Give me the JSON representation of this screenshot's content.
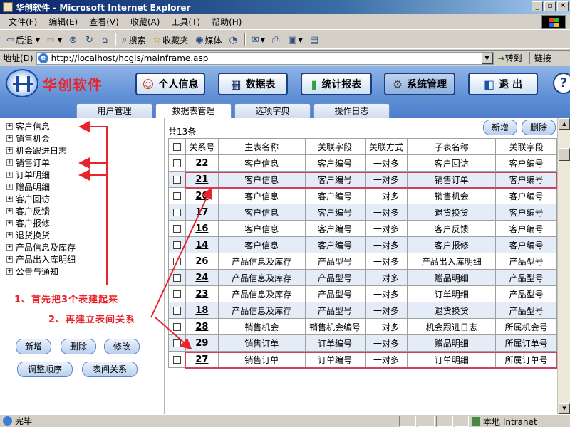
{
  "window": {
    "title": "华创软件 - Microsoft Internet Explorer",
    "buttons": [
      "_",
      "▫",
      "✕"
    ]
  },
  "menu": [
    "文件(F)",
    "编辑(E)",
    "查看(V)",
    "收藏(A)",
    "工具(T)",
    "帮助(H)"
  ],
  "toolbar": {
    "back": "后退",
    "search": "搜索",
    "favorites": "收藏夹",
    "media": "媒体"
  },
  "address": {
    "label": "地址(D)",
    "url": "http://localhost/hcgis/mainframe.asp",
    "go": "转到",
    "links": "链接"
  },
  "app": {
    "logo": "华创软件",
    "nav": [
      "个人信息",
      "数据表",
      "统计报表",
      "系统管理",
      "退 出"
    ],
    "help": "?",
    "tabs": [
      "用户管理",
      "数据表管理",
      "选项字典",
      "操作日志"
    ]
  },
  "tree": [
    "客户信息",
    "销售机会",
    "机会跟进日志",
    "销售订单",
    "订单明细",
    "赠品明细",
    "客户回访",
    "客户反馈",
    "客户报修",
    "退货换货",
    "产品信息及库存",
    "产品出入库明细",
    "公告与通知"
  ],
  "left_buttons": {
    "add": "新增",
    "delete": "删除",
    "edit": "修改",
    "reorder": "调整顺序",
    "relations": "表间关系"
  },
  "annotations": {
    "step1": "1、首先把3个表建起来",
    "step2": "2、再建立表间关系"
  },
  "table": {
    "count": "共13条",
    "add": "新增",
    "delete": "删除",
    "headers": [
      "关系号",
      "主表名称",
      "关联字段",
      "关联方式",
      "子表名称",
      "关联字段"
    ],
    "rows": [
      [
        "22",
        "客户信息",
        "客户编号",
        "一对多",
        "客户回访",
        "客户编号"
      ],
      [
        "21",
        "客户信息",
        "客户编号",
        "一对多",
        "销售订单",
        "客户编号"
      ],
      [
        "20",
        "客户信息",
        "客户编号",
        "一对多",
        "销售机会",
        "客户编号"
      ],
      [
        "17",
        "客户信息",
        "客户编号",
        "一对多",
        "退货换货",
        "客户编号"
      ],
      [
        "16",
        "客户信息",
        "客户编号",
        "一对多",
        "客户反馈",
        "客户编号"
      ],
      [
        "14",
        "客户信息",
        "客户编号",
        "一对多",
        "客户报修",
        "客户编号"
      ],
      [
        "26",
        "产品信息及库存",
        "产品型号",
        "一对多",
        "产品出入库明细",
        "产品型号"
      ],
      [
        "24",
        "产品信息及库存",
        "产品型号",
        "一对多",
        "赠品明细",
        "产品型号"
      ],
      [
        "23",
        "产品信息及库存",
        "产品型号",
        "一对多",
        "订单明细",
        "产品型号"
      ],
      [
        "18",
        "产品信息及库存",
        "产品型号",
        "一对多",
        "退货换货",
        "产品型号"
      ],
      [
        "28",
        "销售机会",
        "销售机会编号",
        "一对多",
        "机会跟进日志",
        "所属机会号"
      ],
      [
        "29",
        "销售订单",
        "订单编号",
        "一对多",
        "赠品明细",
        "所属订单号"
      ],
      [
        "27",
        "销售订单",
        "订单编号",
        "一对多",
        "订单明细",
        "所属订单号"
      ]
    ]
  },
  "status": {
    "text": "完毕",
    "zone": "本地 Intranet"
  }
}
